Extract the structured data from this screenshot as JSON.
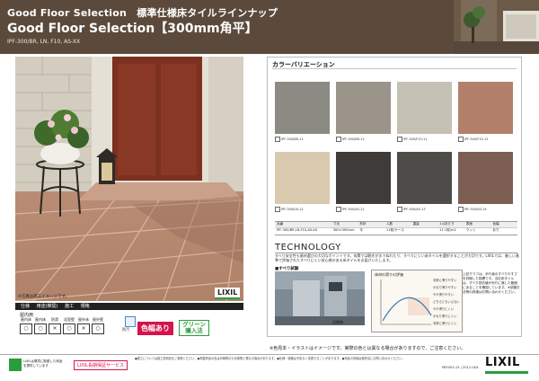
{
  "header": {
    "series_title": "Good Floor Selection　標準仕様床タイルラインナップ",
    "main_title": "Good Floor Selection【300mm角平】",
    "product_codes": "IPF-300/BR, LN, F10, AS-XX"
  },
  "photo": {
    "caption": "※写真は施工イメージです。",
    "logo_text": "LIXIL"
  },
  "spec": {
    "bar_items": [
      "仕様",
      "用途(推奨)",
      "施工",
      "規格"
    ],
    "use_heading": "屋内用",
    "uses": [
      {
        "label": "屋内床",
        "mark": "○"
      },
      {
        "label": "屋内床",
        "mark": "○"
      },
      {
        "label": "防滑",
        "mark": "×"
      },
      {
        "label": "浴室壁",
        "mark": "○"
      },
      {
        "label": "屋外床",
        "mark": "×"
      },
      {
        "label": "屋外壁",
        "mark": "○"
      }
    ],
    "badge_label": "防汚",
    "color_badge": "色幅あり",
    "green_badge_line1": "グリーン",
    "green_badge_line2": "購入法"
  },
  "color_variation": {
    "title": "カラーバリエーション",
    "tiles": [
      {
        "code": "IPF-300/BR-11",
        "color": "#8b8a83"
      },
      {
        "code": "IPF-300/BR-12",
        "color": "#9b948a"
      },
      {
        "code": "IPF-300/F10-11",
        "color": "#c4c0b4"
      },
      {
        "code": "IPF-300/F10-12",
        "color": "#b3806b"
      },
      {
        "code": "IPF-300/LN-12",
        "color": "#d9c9ae"
      },
      {
        "code": "IPF-300/AS-12",
        "color": "#3e3b38"
      },
      {
        "code": "IPF-300/AS-13",
        "color": "#4e4c48"
      },
      {
        "code": "IPF-300/AS-14",
        "color": "#7c5e52"
      }
    ],
    "table_headers": [
      "品番",
      "寸法",
      "形状",
      "入数",
      "重量",
      "1㎡あたり",
      "表面",
      "色幅"
    ],
    "table_values": [
      "IPF-300/BR,LN,F10,AS-XX",
      "300×300mm",
      "平",
      "11枚/ケース",
      "",
      "11.1枚/m2",
      "マット",
      "あり"
    ]
  },
  "technology": {
    "title": "TECHNOLOGY",
    "text": "すべり安全性も基材選びの大切なポイントです。玄関では靴先が水でぬれたり、すべりにくい床タイルを選択することが大切です。LIXILでは、厳しい基準で評価されたすべりにくい安心感のある床タイルをお届けいたします。",
    "test_label": "■すべり試験",
    "machine_caption": "試験機",
    "graph_title": "床材の滑りの評価",
    "graph_labels": [
      "非常に滑りやすい",
      "かなり滑りやすい",
      "やや滑りやすい",
      "どちらともいえない",
      "やや滑りにくい",
      "かなり滑りにくい",
      "非常に滑りにくい"
    ],
    "graph_note": "上記グラフは、歩行者のすべりやすさを評価した指標です。当社床タイルは、すべり抵抗値が歩行に適した範囲にあることを確認しています。※試験方法等の詳細はお問い合わせください。"
  },
  "notes": {
    "bottom": "※色見本・イラストはイメージです。実際の色とは異なる場合がありますので、ご注意ください。"
  },
  "footer": {
    "green_text": "LIXILは環境に配慮した商品を提供しています",
    "warranty": "LIXIL長期保証サービス",
    "fine_print": "●施工については施工説明書をご参照ください。●掲載商品の色は印刷物のため実物と異なる場合があります。●仕様・価格は予告なく変更することがあります。●商品の詳細は販売店にお問い合わせください。",
    "code": "PBF003-15 | 2012-0XX",
    "logo": "LIXIL"
  }
}
